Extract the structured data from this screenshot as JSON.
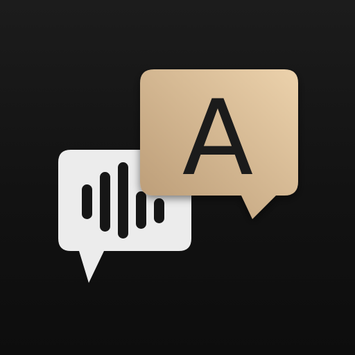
{
  "icon": {
    "name": "voice-translator-app-icon",
    "letter": "A",
    "glyphs": [
      "speech-bubble-icon",
      "waveform-icon",
      "translation-bubble-icon"
    ]
  },
  "colors": {
    "background_top": "#1c1c1c",
    "background_bottom": "#0d0d0d",
    "speech_bubble": "#ececec",
    "waveform": "#161616",
    "translation_bubble_light": "#ecd2ac",
    "translation_bubble_dark": "#b99a75",
    "letter": "#1b1b1b"
  }
}
